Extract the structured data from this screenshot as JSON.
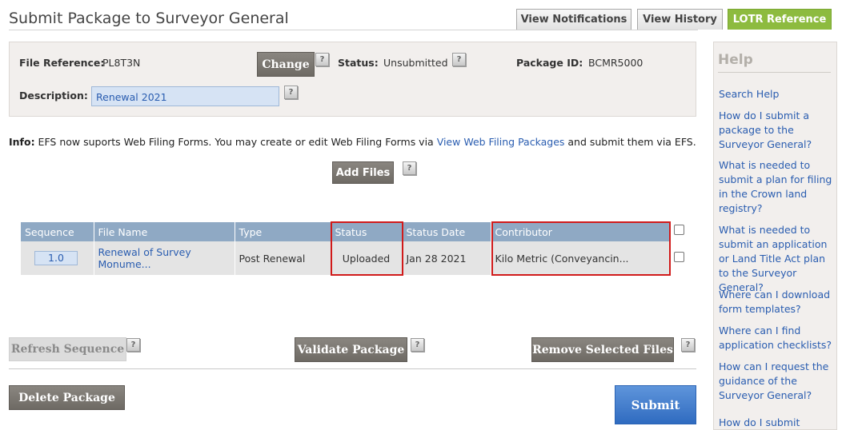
{
  "header": {
    "title": "Submit Package to Surveyor General",
    "tabs": [
      {
        "label": "View Notifications"
      },
      {
        "label": "View History"
      },
      {
        "label": "LOTR Reference"
      }
    ]
  },
  "package": {
    "file_reference_label": "File Reference:",
    "file_reference_value": "PL8T3N",
    "change_label": "Change",
    "status_label": "Status:",
    "status_value": "Unsubmitted",
    "package_id_label": "Package ID:",
    "package_id_value": "BCMR5000",
    "description_label": "Description:",
    "description_value": "Renewal 2021",
    "help_glyph": "?"
  },
  "info": {
    "prefix": "Info:",
    "text_before": " EFS now suports Web Filing Forms. You may create or edit Web Filing Forms via ",
    "link": "View Web Filing Packages",
    "text_after": " and submit them via EFS."
  },
  "add_files_label": "Add Files",
  "files_table": {
    "headers": [
      "Sequence",
      "File Name",
      "Type",
      "Status",
      "Status Date",
      "Contributor"
    ],
    "rows": [
      {
        "sequence": "1.0",
        "file_name": "Renewal of Survey Monume...",
        "type": "Post Renewal",
        "status": "Uploaded",
        "status_date": "Jan 28 2021",
        "contributor": "Kilo Metric (Conveyancin..."
      }
    ]
  },
  "actions": {
    "refresh_sequence": "Refresh Sequence",
    "validate_package": "Validate Package",
    "remove_selected_files": "Remove Selected Files",
    "delete_package": "Delete Package",
    "submit": "Submit"
  },
  "help": {
    "title": "Help",
    "links": [
      "Search Help",
      "How do I submit a package to the Surveyor General?",
      "What is needed to submit a plan for filing in the Crown land registry?",
      "What is needed to submit an application or Land Title Act plan to the Surveyor General?",
      "Where can I download form templates?",
      "Where can I find application checklists?",
      "How can I request the guidance of the Surveyor General?",
      "How do I submit"
    ]
  },
  "colors": {
    "tab_accent": "#8dbb3f",
    "table_header": "#8fa9c4",
    "highlight": "#d11a1a",
    "submit": "#2f6bc0",
    "link": "#2a5db0"
  }
}
